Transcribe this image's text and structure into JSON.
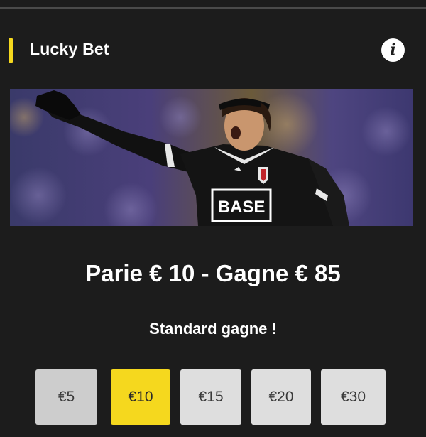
{
  "header": {
    "title": "Lucky Bet",
    "info_icon": "info-icon"
  },
  "banner": {
    "description_icon": "player-photo",
    "shirt_text": "BASE"
  },
  "offer": {
    "headline": "Parie € 10 - Gagne € 85",
    "subtitle": "Standard gagne !"
  },
  "stakes": [
    {
      "label": "€5",
      "selected": false
    },
    {
      "label": "€10",
      "selected": true
    },
    {
      "label": "€15",
      "selected": false
    },
    {
      "label": "€20",
      "selected": false
    },
    {
      "label": "€30",
      "selected": false
    }
  ],
  "colors": {
    "accent": "#f5d81e",
    "background": "#1c1c1c",
    "button": "#dedede"
  }
}
